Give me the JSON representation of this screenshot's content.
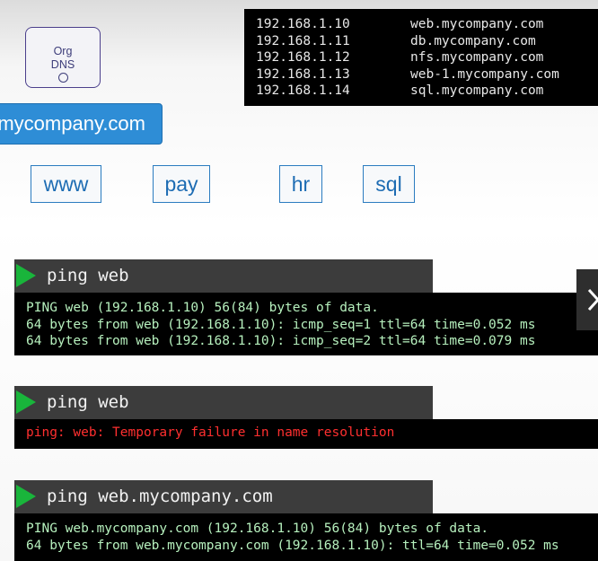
{
  "dns_table": [
    {
      "ip": "192.168.1.10",
      "host": "web.mycompany.com"
    },
    {
      "ip": "192.168.1.11",
      "host": "db.mycompany.com"
    },
    {
      "ip": "192.168.1.12",
      "host": "nfs.mycompany.com"
    },
    {
      "ip": "192.168.1.13",
      "host": "web-1.mycompany.com"
    },
    {
      "ip": "192.168.1.14",
      "host": "sql.mycompany.com"
    }
  ],
  "org_dns": {
    "line1": "Org",
    "line2": "DNS"
  },
  "domain_banner": "mycompany.com",
  "subdomains": [
    "www",
    "pay",
    "hr",
    "sql"
  ],
  "commands": [
    {
      "command": "ping web",
      "output": [
        "PING web (192.168.1.10) 56(84) bytes of data.",
        "64 bytes from web (192.168.1.10): icmp_seq=1 ttl=64 time=0.052 ms",
        "64 bytes from web (192.168.1.10): icmp_seq=2 ttl=64 time=0.079 ms"
      ]
    },
    {
      "command": "ping web",
      "output": [
        "ping: web: Temporary failure in name resolution"
      ]
    },
    {
      "command": "ping web.mycompany.com",
      "output": [
        "PING web.mycompany.com (192.168.1.10) 56(84) bytes of data.",
        "64 bytes from web.mycompany.com (192.168.1.10): ttl=64 time=0.052 ms"
      ]
    }
  ],
  "colors": {
    "play_green": "#19b53b",
    "error_red": "#ff2f2f",
    "banner_blue": "#2e8dd6",
    "terminal_bg": "#000000",
    "command_bar_bg": "#3c3c3c"
  },
  "icons": {
    "next": "chevron-right-icon",
    "run": "play-icon"
  }
}
